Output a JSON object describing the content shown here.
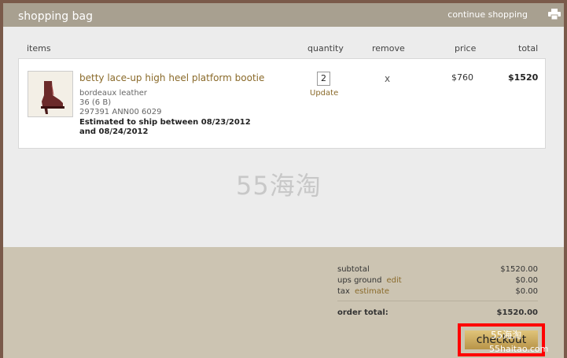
{
  "header": {
    "title": "shopping bag",
    "continue": "continue shopping"
  },
  "columns": {
    "items": "items",
    "quantity": "quantity",
    "remove": "remove",
    "price": "price",
    "total": "total"
  },
  "item": {
    "name": "betty lace-up high heel platform bootie",
    "color": "bordeaux leather",
    "size": "36 (6 B)",
    "sku": "297391 ANN00 6029",
    "ship": "Estimated to ship between 08/23/2012 and 08/24/2012",
    "quantity": "2",
    "update": "Update",
    "remove": "x",
    "price": "$760",
    "total": "$1520"
  },
  "watermark": "55海淘",
  "summary": {
    "subtotal_label": "subtotal",
    "subtotal": "$1520.00",
    "shipping_label": "ups ground",
    "shipping_edit": "edit",
    "shipping": "$0.00",
    "tax_label": "tax",
    "tax_estimate": "estimate",
    "tax": "$0.00",
    "order_total_label": "order total:",
    "order_total": "$1520.00"
  },
  "checkout": {
    "label": "checkout",
    "wm_top": "55海淘",
    "wm_bottom": "55haitao.com"
  },
  "colors": {
    "header": "#a8a090",
    "footer": "#ccc4b2",
    "link": "#8a6a2a",
    "highlight": "#ff0000"
  }
}
